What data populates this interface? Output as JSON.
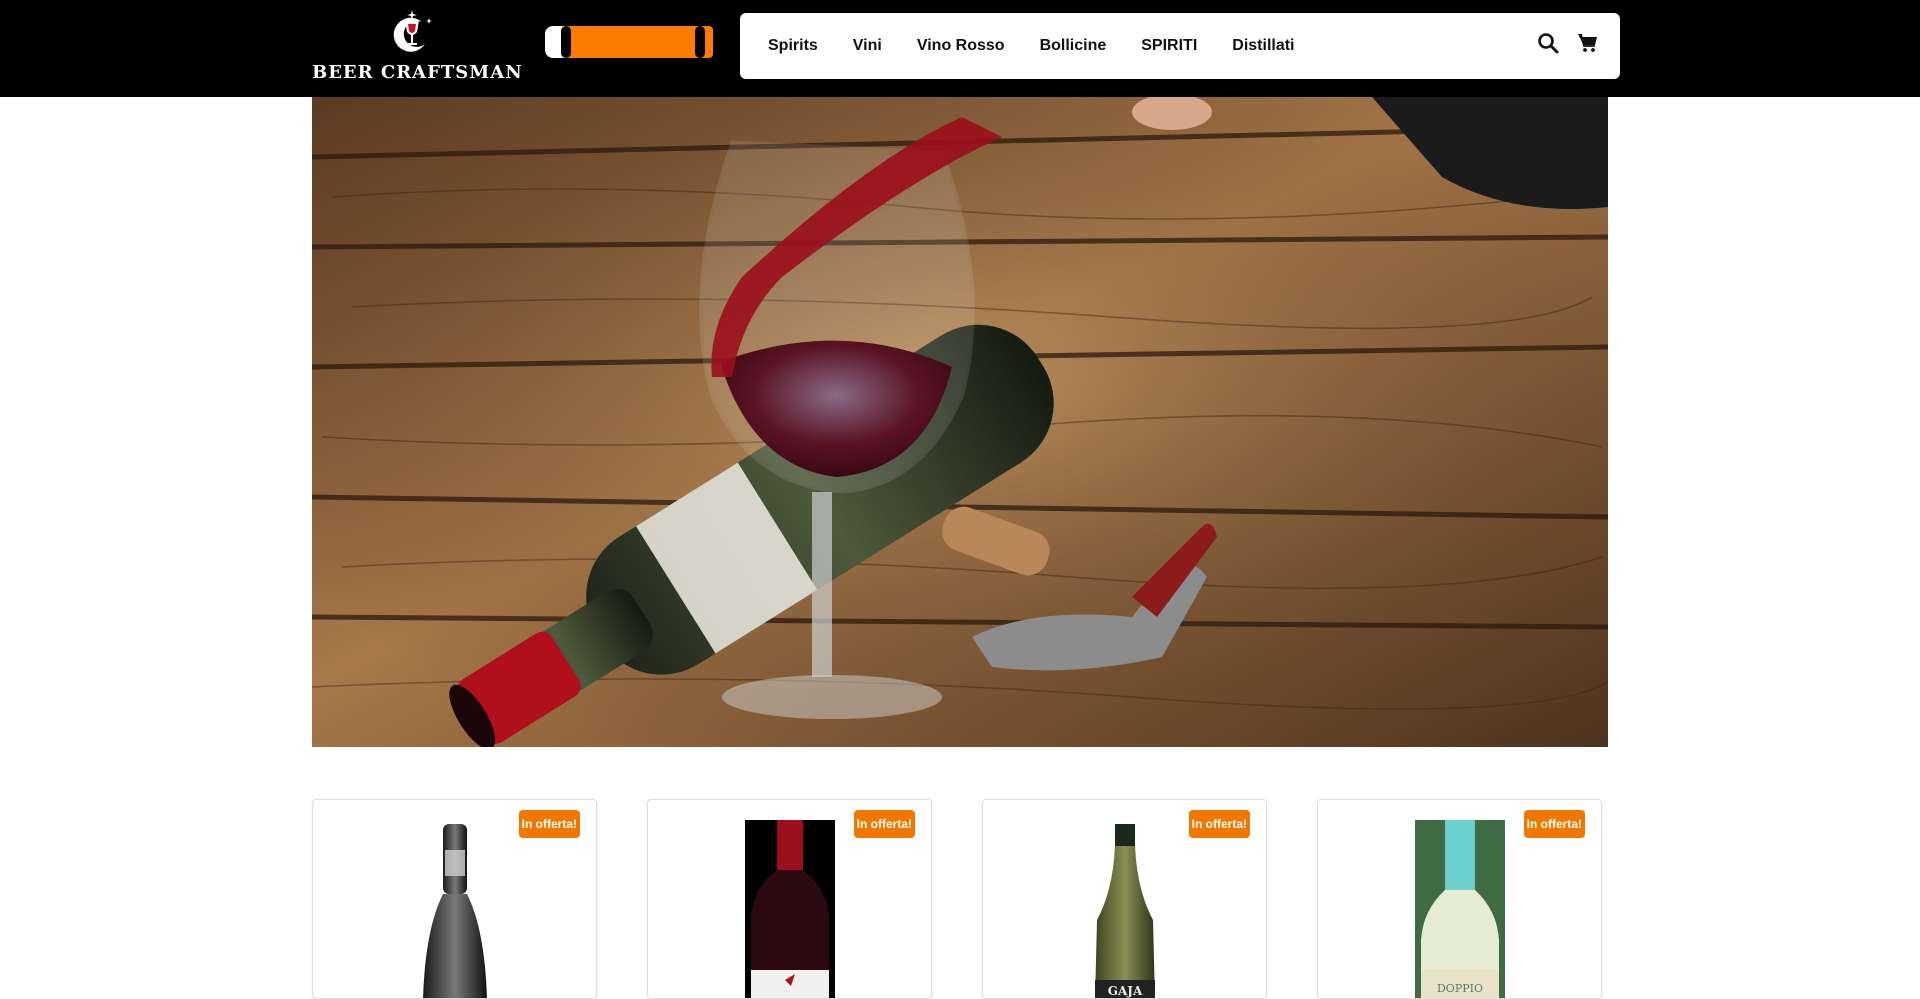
{
  "header": {
    "logo_text": "BEER CRAFTSMAN",
    "nav": [
      {
        "label": "Spirits"
      },
      {
        "label": "Vini"
      },
      {
        "label": "Vino Rosso"
      },
      {
        "label": "Bollicine"
      },
      {
        "label": "SPIRITI"
      },
      {
        "label": "Distillati"
      }
    ],
    "icons": [
      "search-icon",
      "cart-icon"
    ]
  },
  "hero": {
    "image": "red wine poured into glass, bottle and corkscrew on wooden table"
  },
  "products": [
    {
      "badge": "In offerta!"
    },
    {
      "badge": "In offerta!",
      "label_text": ""
    },
    {
      "badge": "In offerta!",
      "label_text": "GAJA"
    },
    {
      "badge": "In offerta!",
      "label_text": "DOPPIO"
    }
  ],
  "colors": {
    "accent": "#f07800",
    "header_bg": "#000000",
    "nav_bg": "#ffffff"
  }
}
